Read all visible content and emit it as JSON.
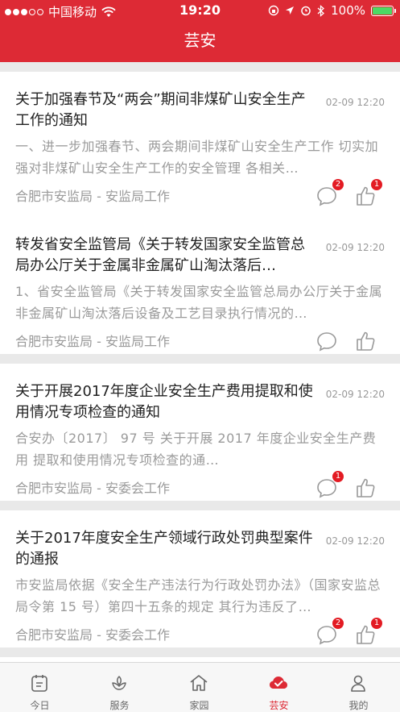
{
  "status": {
    "carrier": "中国移动",
    "time": "19:20",
    "battery": "100%"
  },
  "header": {
    "title": "芸安"
  },
  "articles": [
    {
      "title": "关于加强春节及“两会”期间非煤矿山安全生产工作的通知",
      "date": "02-09 12:20",
      "summary": "一、进一步加强春节、两会期间非煤矿山安全生产工作 切实加强对非煤矿山安全生产工作的安全管理 各相关…",
      "source": "合肥市安监局 - 安监局工作",
      "comments": "2",
      "likes": "1"
    },
    {
      "title": "转发省安全监管局《关于转发国家安全监管总局办公厅关于金属非金属矿山淘汰落后…",
      "date": "02-09 12:20",
      "summary": "1、省安全监管局《关于转发国家安全监管总局办公厅关于金属非金属矿山淘汰落后设备及工艺目录执行情况的…",
      "source": "合肥市安监局 - 安监局工作",
      "comments": "",
      "likes": ""
    },
    {
      "title": "关于开展2017年度企业安全生产费用提取和使用情况专项检查的通知",
      "date": "02-09 12:20",
      "summary": "合安办〔2017〕 97 号 关于开展 2017 年度企业安全生产费用 提取和使用情况专项检查的通…",
      "source": "合肥市安监局 - 安委会工作",
      "comments": "1",
      "likes": ""
    },
    {
      "title": "关于2017年度安全生产领域行政处罚典型案件的通报",
      "date": "02-09 12:20",
      "summary": "市安监局依据《安全生产违法行为行政处罚办法》（国家安监总局令第 15 号）第四十五条的规定 其行为违反了…",
      "source": "合肥市安监局 - 安委会工作",
      "comments": "2",
      "likes": "1"
    }
  ],
  "tabs": [
    {
      "label": "今日",
      "icon": "calendar-icon"
    },
    {
      "label": "服务",
      "icon": "sprout-icon"
    },
    {
      "label": "家园",
      "icon": "home-icon"
    },
    {
      "label": "芸安",
      "icon": "cloud-check-icon",
      "active": true
    },
    {
      "label": "我的",
      "icon": "person-icon"
    }
  ],
  "colors": {
    "brand": "#dd2a35",
    "badge": "#e31b23",
    "battery": "#4cd964"
  }
}
